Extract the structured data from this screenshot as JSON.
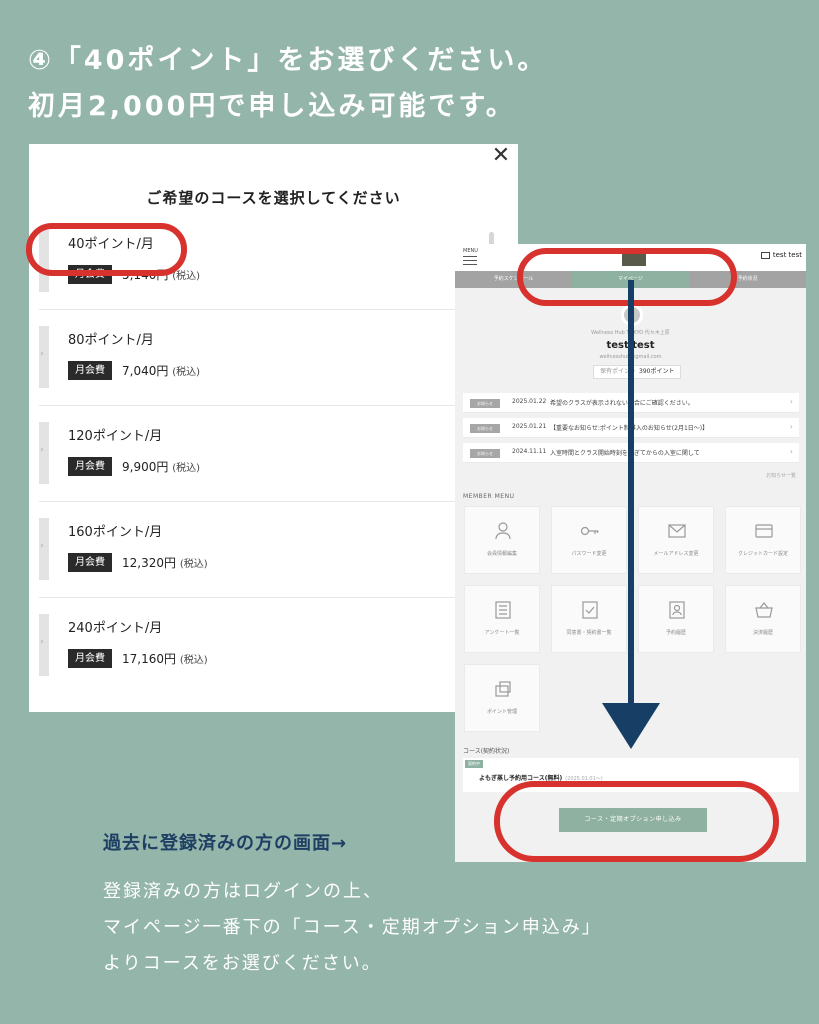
{
  "heading": {
    "line1": "④「40ポイント」をお選びください。",
    "line2": "初月2,000円で申し込み可能です。"
  },
  "modal": {
    "close_icon": "close-icon",
    "title": "ご希望のコースを選択してください",
    "courses": [
      {
        "name": "40ポイント/月",
        "fee_label": "月会費",
        "price": "5,140円",
        "tax": "(税込)"
      },
      {
        "name": "80ポイント/月",
        "fee_label": "月会費",
        "price": "7,040円",
        "tax": "(税込)"
      },
      {
        "name": "120ポイント/月",
        "fee_label": "月会費",
        "price": "9,900円",
        "tax": "(税込)"
      },
      {
        "name": "160ポイント/月",
        "fee_label": "月会費",
        "price": "12,320円",
        "tax": "(税込)"
      },
      {
        "name": "240ポイント/月",
        "fee_label": "月会費",
        "price": "17,160円",
        "tax": "(税込)"
      }
    ]
  },
  "mypage": {
    "menu_label": "MENU",
    "user_label": "test test",
    "tabs": [
      "予約スケジュール",
      "マイページ",
      "予約状況"
    ],
    "studio": "Wellness Hub TOKYO 代々木上原",
    "user_name": "test test",
    "email": "wellnesshub@gmail.com",
    "points_label": "保有ポイント",
    "points_value": "390ポイント",
    "notices": [
      {
        "tag": "お知らせ",
        "date": "2025.01.22",
        "text": "希望のクラスが表示されない場合にご確認ください。"
      },
      {
        "tag": "お知らせ",
        "date": "2025.01.21",
        "text": "【重要なお知らせ:ポイント制導入のお知らせ(2月1日〜)】"
      },
      {
        "tag": "お知らせ",
        "date": "2024.11.11",
        "text": "入室時間とクラス開始時刻を過ぎてからの入室に関して"
      }
    ],
    "notices_more": "お知らせ一覧",
    "member_menu_label": "MEMBER MENU",
    "tiles": [
      {
        "icon": "user-icon",
        "label": "会員情報編集"
      },
      {
        "icon": "key-icon",
        "label": "パスワード変更"
      },
      {
        "icon": "mail-icon",
        "label": "メールアドレス変更"
      },
      {
        "icon": "credit-card-icon",
        "label": "クレジットカード設定"
      },
      {
        "icon": "survey-icon",
        "label": "アンケート一覧"
      },
      {
        "icon": "agreement-icon",
        "label": "同意書・契約書一覧"
      },
      {
        "icon": "history-icon",
        "label": "予約履歴"
      },
      {
        "icon": "basket-icon",
        "label": "決済履歴"
      },
      {
        "icon": "points-icon",
        "label": "ポイント管理"
      }
    ],
    "course_section_label": "コース(契約状況)",
    "course_tag": "契約中",
    "course_name": "よもぎ蒸し予約用コース(無料)",
    "course_date": "(2025.01.01〜)",
    "apply_button": "コース・定期オプション申し込み"
  },
  "caption": {
    "title": "過去に登録済みの方の画面→",
    "lines": [
      "登録済みの方はログインの上、",
      "マイページ一番下の「コース・定期オプション申込み」",
      "よりコースをお選びください。"
    ]
  },
  "colors": {
    "background": "#94b5a9",
    "highlight_ring": "#d7322e",
    "arrow": "#173f66",
    "accent": "#8fb1a2"
  }
}
